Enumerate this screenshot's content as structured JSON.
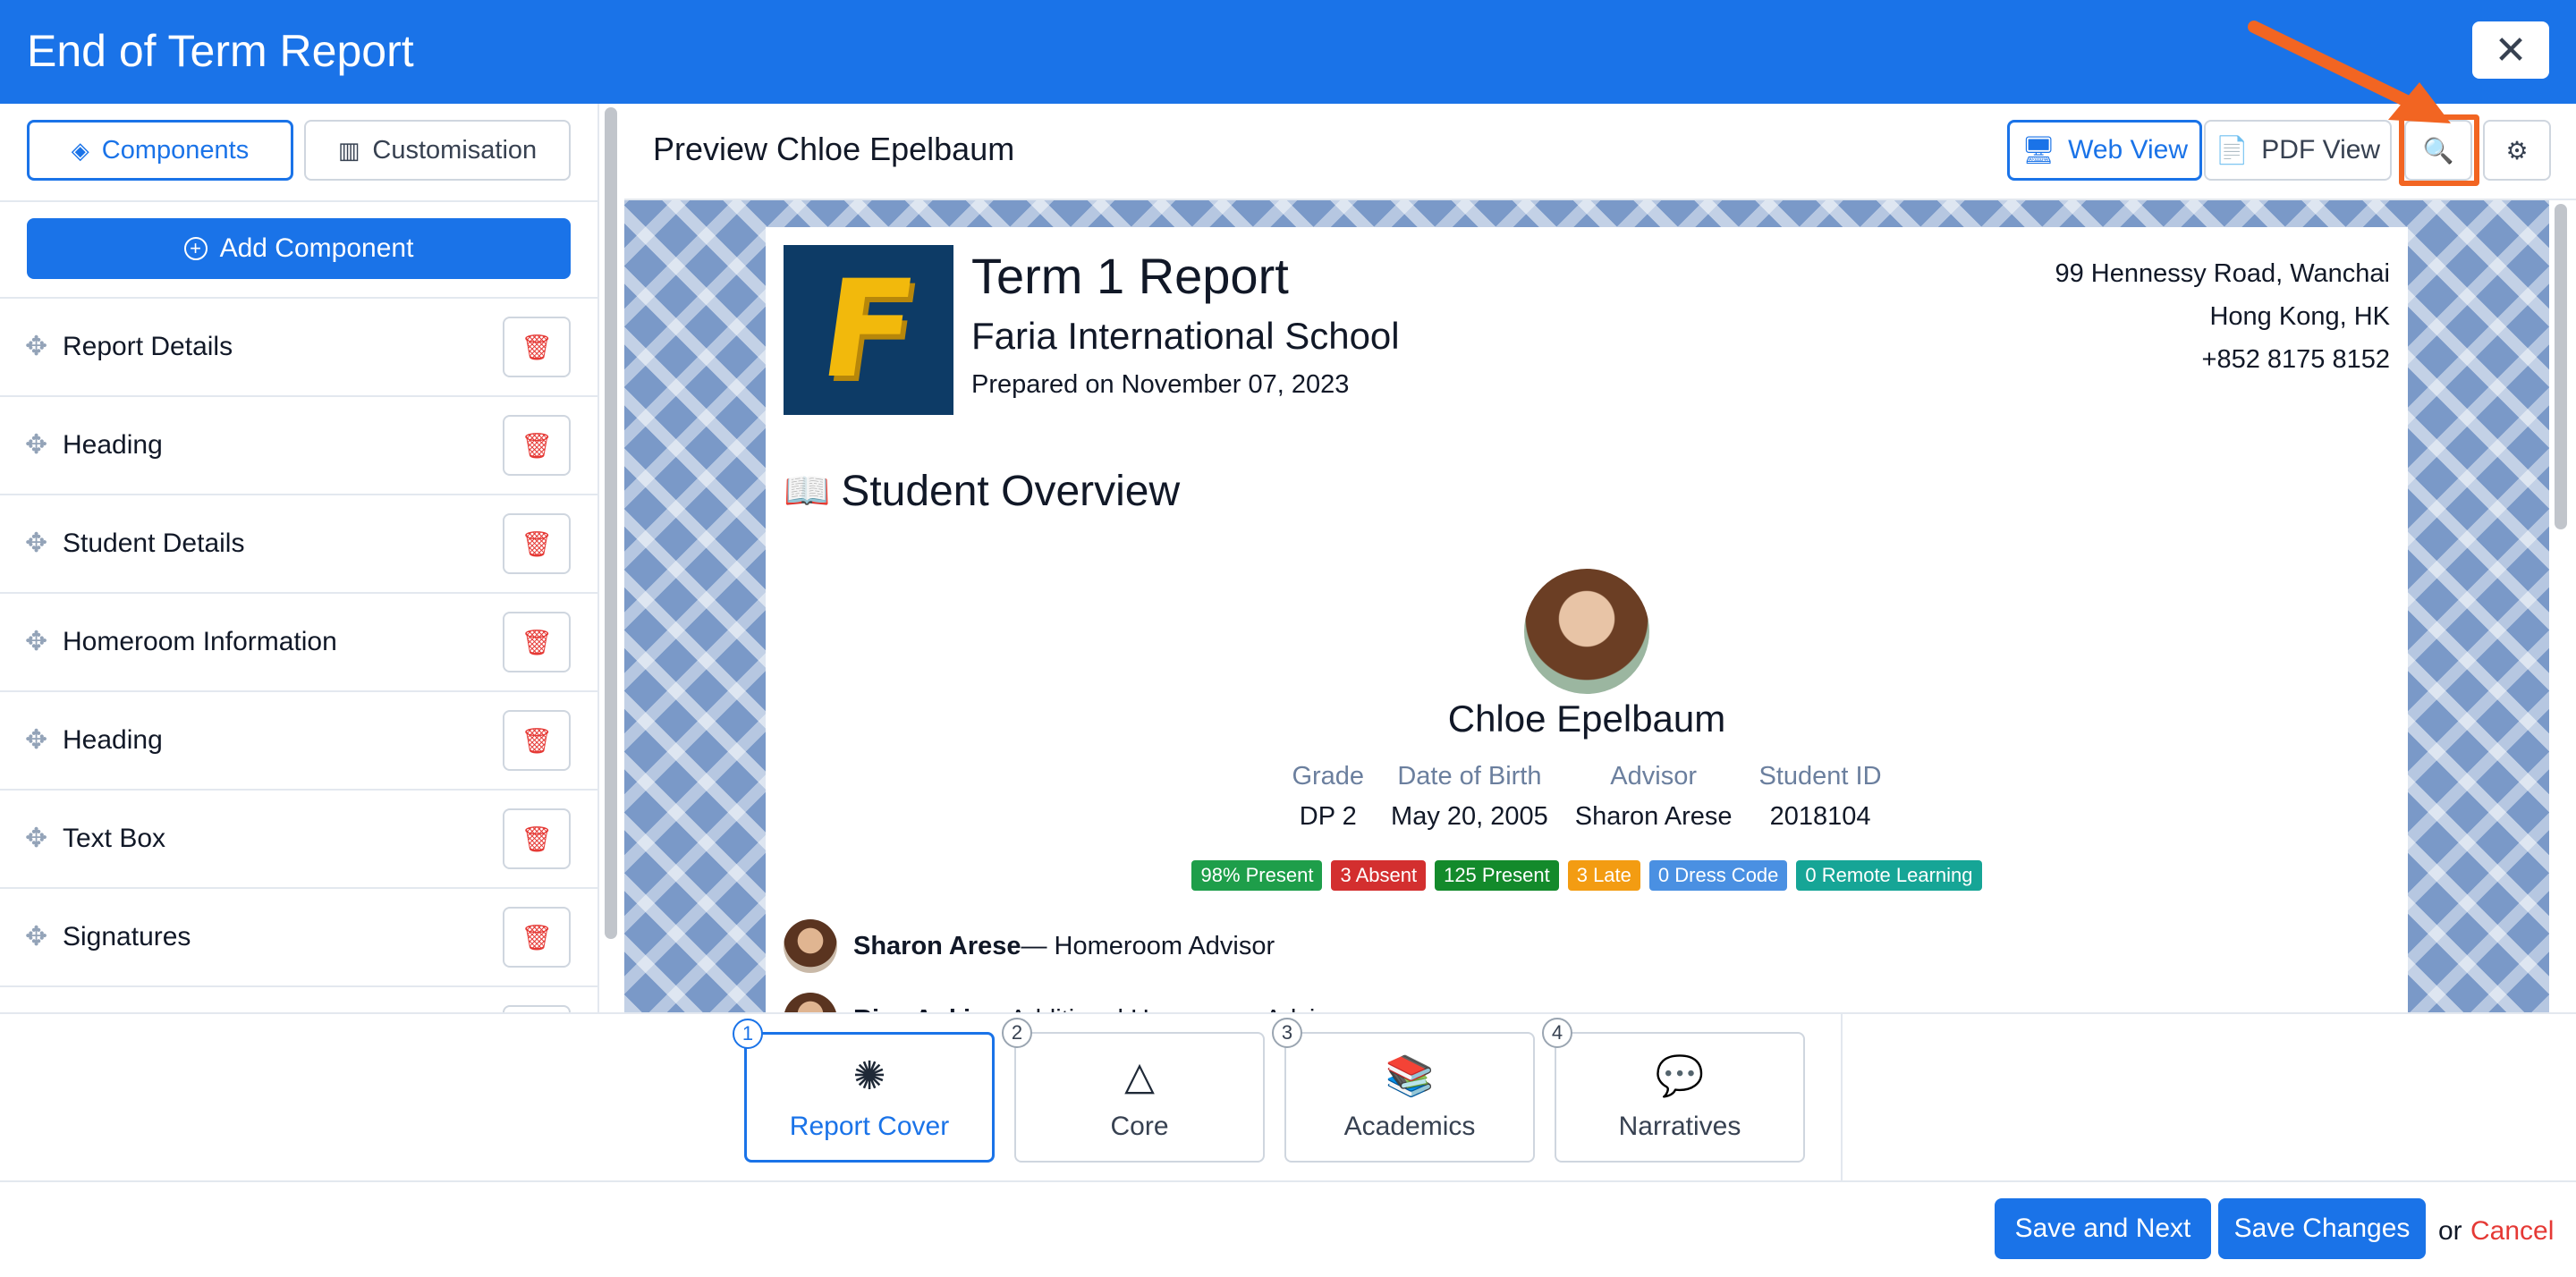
{
  "header": {
    "title": "End of Term Report",
    "close_icon": "close-icon"
  },
  "left_panel": {
    "tabs": [
      {
        "label": "Components",
        "icon": "layers-icon",
        "active": true
      },
      {
        "label": "Customisation",
        "icon": "sliders-icon",
        "active": false
      }
    ],
    "add_button": "Add Component",
    "components": [
      {
        "label": "Report Details"
      },
      {
        "label": "Heading"
      },
      {
        "label": "Student Details"
      },
      {
        "label": "Homeroom Information"
      },
      {
        "label": "Heading"
      },
      {
        "label": "Text Box"
      },
      {
        "label": "Signatures"
      }
    ]
  },
  "preview": {
    "title": "Preview Chloe Epelbaum",
    "web_view": "Web View",
    "pdf_view": "PDF View",
    "highlight_color": "#f26522"
  },
  "report": {
    "logo_letter": "F",
    "title": "Term 1 Report",
    "school": "Faria International School",
    "prepared": "Prepared on November 07, 2023",
    "address": [
      "99 Hennessy Road, Wanchai",
      "Hong Kong, HK",
      "+852 8175 8152"
    ],
    "section_title": "Student Overview",
    "student_name": "Chloe Epelbaum",
    "details": [
      {
        "label": "Grade",
        "value": "DP 2"
      },
      {
        "label": "Date of Birth",
        "value": "May 20, 2005"
      },
      {
        "label": "Advisor",
        "value": "Sharon Arese"
      },
      {
        "label": "Student ID",
        "value": "2018104"
      }
    ],
    "badges": [
      {
        "text": "98% Present",
        "color": "#1e9e4a"
      },
      {
        "text": "3 Absent",
        "color": "#d32f2f"
      },
      {
        "text": "125 Present",
        "color": "#138a2b"
      },
      {
        "text": "3 Late",
        "color": "#f39c12"
      },
      {
        "text": "0 Dress Code",
        "color": "#4a90e2"
      },
      {
        "text": "0 Remote Learning",
        "color": "#16a596"
      }
    ],
    "advisors": [
      {
        "name": "Sharon Arese",
        "role": "— Homeroom Advisor"
      },
      {
        "name": "Risa Aoki",
        "role": " — Additional Homeroom Advisors"
      }
    ]
  },
  "steps": [
    {
      "num": "1",
      "label": "Report Cover",
      "active": true
    },
    {
      "num": "2",
      "label": "Core",
      "active": false
    },
    {
      "num": "3",
      "label": "Academics",
      "active": false
    },
    {
      "num": "4",
      "label": "Narratives",
      "active": false
    }
  ],
  "footer": {
    "save_next": "Save and Next",
    "save_changes": "Save Changes",
    "or": "or",
    "cancel": "Cancel"
  }
}
